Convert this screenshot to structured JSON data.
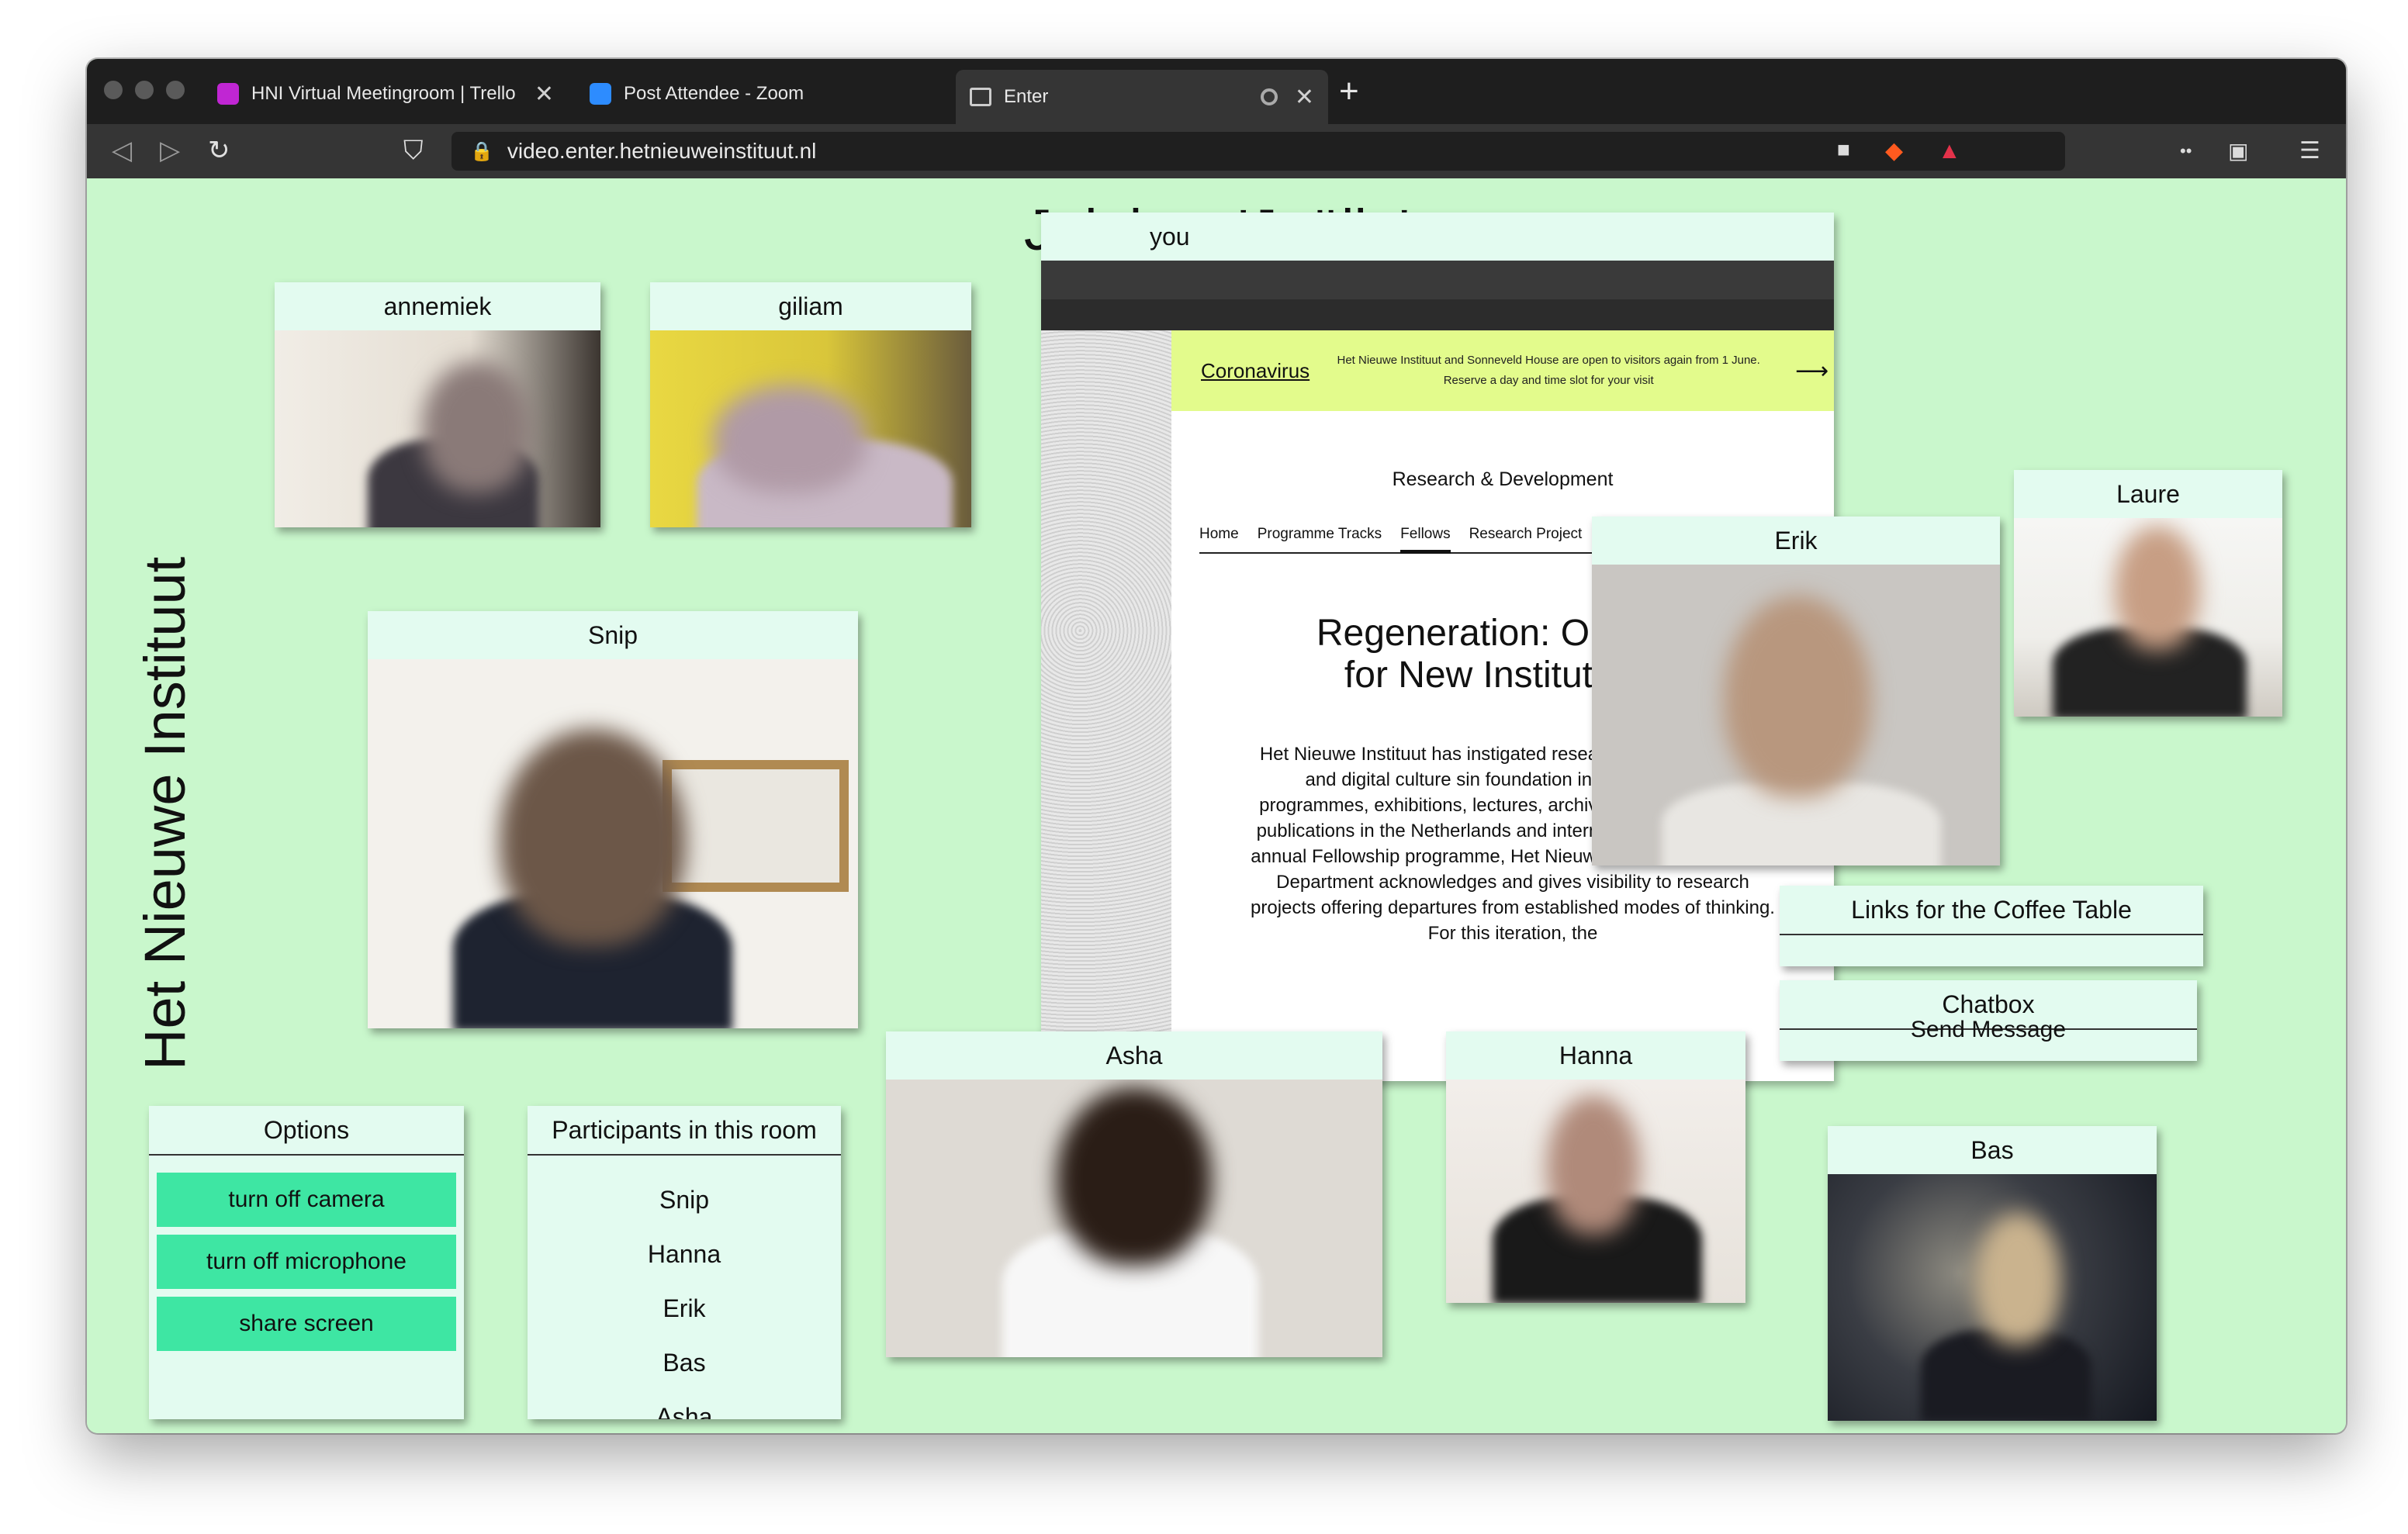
{
  "browser": {
    "tabs": [
      {
        "label": "HNI Virtual Meetingroom | Trello",
        "favicon": "trello-icon",
        "color": "#c026d3"
      },
      {
        "label": "Post Attendee - Zoom",
        "favicon": "zoom-icon",
        "color": "#2d8cff"
      },
      {
        "label": "Enter",
        "favicon": "monitor-icon",
        "color": "#cccccc"
      }
    ],
    "url": "video.enter.hetnieuweinstituut.nl",
    "new_tab": "+",
    "close_glyph": "✕"
  },
  "page": {
    "joining": "Joining: 'Joëlle'",
    "vertical_title": "Het Nieuwe Instituut"
  },
  "tiles": {
    "annemiek": "annemiek",
    "giliam": "giliam",
    "you": "you",
    "snip": "Snip",
    "erik": "Erik",
    "laure": "Laure",
    "asha": "Asha",
    "hanna": "Hanna",
    "bas": "Bas"
  },
  "share": {
    "corona_title": "Coronavirus",
    "corona_text": "Het Nieuwe Instituut and Sonneveld House are open to visitors again from 1 June. Reserve a day and time slot for your visit",
    "section": "Research & Development",
    "nav": [
      "Home",
      "Programme Tracks",
      "Fellows",
      "Research Project"
    ],
    "article_title_1": "Regeneration: Open C",
    "article_title_2": "for New Institutions",
    "article_body": "Het Nieuwe Instituut has instigated resea architecture, design and digital culture sin foundation in 2013, fostering programmes, exhibitions, lectures, archival investigations and publications in the Netherlands and internationally. Through its annual Fellowship programme, Het Nieuwe Instituut's Research Department acknowledges and gives visibility to research projects offering departures from established modes of thinking. For this iteration, the"
  },
  "options": {
    "title": "Options",
    "camera": "turn off camera",
    "microphone": "turn off microphone",
    "share": "share screen"
  },
  "participants": {
    "title": "Participants in this room",
    "list": [
      "Snip",
      "Hanna",
      "Erik",
      "Bas",
      "Asha"
    ]
  },
  "links": {
    "title": "Links for the Coffee Table"
  },
  "chatbox": {
    "title": "Chatbox",
    "send": "Send Message"
  },
  "colors": {
    "page_bg": "#c9f7cc",
    "panel_bg": "#e3fbf0",
    "button": "#3ee6a3"
  }
}
